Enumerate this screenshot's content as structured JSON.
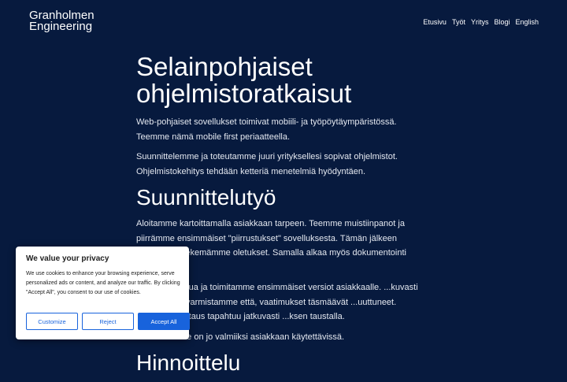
{
  "header": {
    "logo_line1": "Granholmen",
    "logo_line2": "Engineering",
    "nav": [
      "Etusivu",
      "Työt",
      "Yritys",
      "Blogi",
      "English"
    ]
  },
  "main": {
    "title": "Selainpohjaiset ohjelmistoratkaisut",
    "intro_p1": "Web-pohjaiset sovellukset toimivat mobiili- ja työpöytäympäristössä. Teemme nämä mobile first periaatteella.",
    "intro_p2": "Suunnittelemme ja toteutamme juuri yrityksellesi sopivat ohjelmistot. Ohjelmistokehitys tehdään ketteriä menetelmiä hyödyntäen.",
    "design_heading": "Suunnittelutyö",
    "design_p1": "Aloitamme kartoittamalla asiakkaan tarpeen. Teemme muistiinpanot ja piirrämme ensimmäiset \"piirrustukset\" sovelluksesta. Tämän jälkeen verifioimme tekemämme oletukset. Samalla alkaa myös dokumentointi työ.",
    "design_p2": "...aa muodostua ja toimitamme ensimmäiset versiot asiakkaalle. ...kuvasti palautetta ja varmistamme että, vaatimukset täsmäävät ...uuttuneet. Ohjelmistotestaus tapahtuu jatkuvasti ...ksen taustalla.",
    "design_p3": "...valmistuu se on jo valmiiksi asiakkaan käytettävissä.",
    "pricing_heading": "Hinnoittelu"
  },
  "cookie": {
    "title": "We value your privacy",
    "text": "We use cookies to enhance your browsing experience, serve personalized ads or content, and analyze our traffic. By clicking \"Accept All\", you consent to our use of cookies.",
    "customize": "Customize",
    "reject": "Reject",
    "accept": "Accept All"
  }
}
